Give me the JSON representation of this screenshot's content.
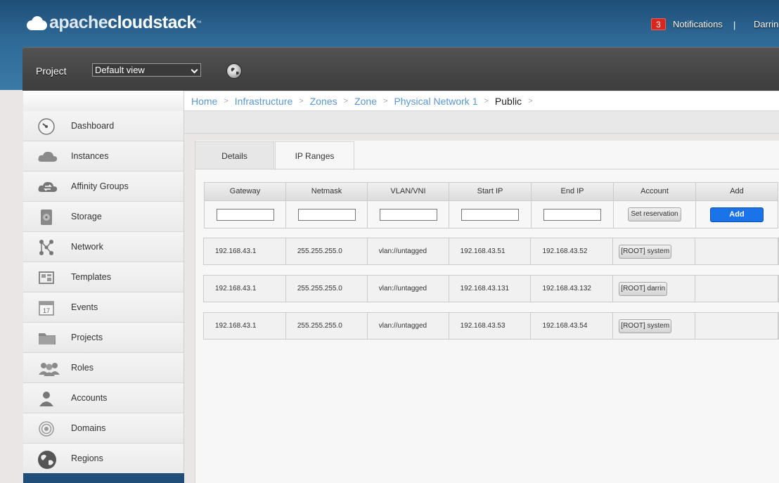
{
  "header": {
    "logo_part1": "apache",
    "logo_part2": "cloudstack",
    "logo_tm": "™",
    "notifications_count": "3",
    "notifications_label": "Notifications",
    "separator": "|",
    "user_name": "Darrin"
  },
  "project_bar": {
    "label": "Project",
    "selected": "Default view",
    "globe_icon": "globe-icon"
  },
  "sidebar": {
    "items": [
      {
        "label": "Dashboard",
        "icon": "dashboard-icon"
      },
      {
        "label": "Instances",
        "icon": "cloud-icon"
      },
      {
        "label": "Affinity Groups",
        "icon": "affinity-cloud-icon"
      },
      {
        "label": "Storage",
        "icon": "disk-icon"
      },
      {
        "label": "Network",
        "icon": "network-icon"
      },
      {
        "label": "Templates",
        "icon": "templates-icon"
      },
      {
        "label": "Events",
        "icon": "calendar-icon"
      },
      {
        "label": "Projects",
        "icon": "folder-icon"
      },
      {
        "label": "Roles",
        "icon": "roles-icon"
      },
      {
        "label": "Accounts",
        "icon": "user-icon"
      },
      {
        "label": "Domains",
        "icon": "domains-icon"
      },
      {
        "label": "Regions",
        "icon": "globe-icon"
      }
    ]
  },
  "breadcrumb": {
    "items": [
      "Home",
      "Infrastructure",
      "Zones",
      "Zone",
      "Physical Network 1"
    ],
    "current": "Public",
    "sep": ">"
  },
  "tabs": {
    "details": "Details",
    "ip_ranges": "IP Ranges"
  },
  "form": {
    "columns": [
      "Gateway",
      "Netmask",
      "VLAN/VNI",
      "Start IP",
      "End IP",
      "Account",
      "Add"
    ],
    "set_reservation_label": "Set reservation",
    "add_label": "Add"
  },
  "ip_ranges": [
    {
      "gateway": "192.168.43.1",
      "netmask": "255.255.255.0",
      "vlan": "vlan://untagged",
      "start_ip": "192.168.43.51",
      "end_ip": "192.168.43.52",
      "account": "[ROOT] system"
    },
    {
      "gateway": "192.168.43.1",
      "netmask": "255.255.255.0",
      "vlan": "vlan://untagged",
      "start_ip": "192.168.43.131",
      "end_ip": "192.168.43.132",
      "account": "[ROOT] darrin"
    },
    {
      "gateway": "192.168.43.1",
      "netmask": "255.255.255.0",
      "vlan": "vlan://untagged",
      "start_ip": "192.168.43.53",
      "end_ip": "192.168.43.54",
      "account": "[ROOT] system"
    }
  ],
  "colors": {
    "header_blue": "#2f6a97",
    "link_blue": "#5b97cf",
    "add_button": "#1a73e8",
    "badge_red": "#d9261c"
  }
}
